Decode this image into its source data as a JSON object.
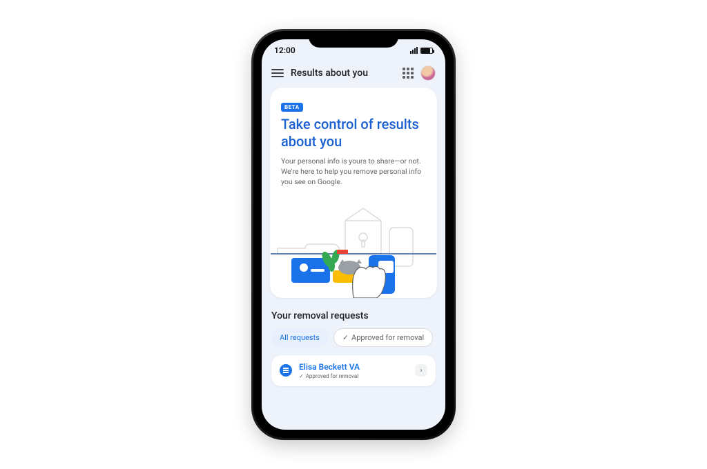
{
  "status": {
    "time": "12:00"
  },
  "header": {
    "title": "Results about you"
  },
  "hero": {
    "badge": "BETA",
    "title": "Take control of results about you",
    "subtitle": "Your personal info is yours to share—or not. We're here to help you remove personal info you see on Google."
  },
  "removals": {
    "title": "Your removal requests",
    "chips": [
      {
        "label": "All requests",
        "active": true
      },
      {
        "label": "Approved for removal",
        "active": false,
        "icon": "check"
      }
    ],
    "items": [
      {
        "title": "Elisa Beckett VA",
        "status": "Approved for removal"
      }
    ]
  }
}
